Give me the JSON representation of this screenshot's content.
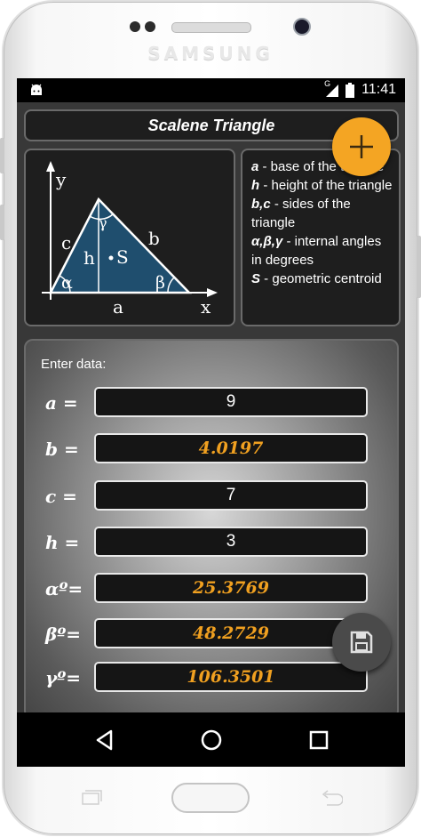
{
  "device": {
    "brand": "SAMSUNG"
  },
  "status_bar": {
    "network_label": "G",
    "time": "11:41"
  },
  "app": {
    "title": "Scalene Triangle",
    "diagram": {
      "axis_y": "y",
      "axis_x": "x",
      "side_a": "a",
      "side_b": "b",
      "side_c": "c",
      "height": "h",
      "centroid": "S",
      "angle_alpha": "α",
      "angle_beta": "β",
      "angle_gamma": "γ"
    },
    "legend": [
      {
        "key": "a",
        "text": " - base of the triangle"
      },
      {
        "key": "h",
        "text": " - height of the triangle"
      },
      {
        "key": "b,c",
        "text": " - sides of the triangle"
      },
      {
        "key": "α,β,γ",
        "text": " - internal angles in degrees"
      },
      {
        "key": "S",
        "text": " - geometric centroid"
      }
    ],
    "form": {
      "label": "Enter data:",
      "fields": [
        {
          "label": "a =",
          "value": "9",
          "computed": false
        },
        {
          "label": "b =",
          "value": "4.0197",
          "computed": true
        },
        {
          "label": "c =",
          "value": "7",
          "computed": false
        },
        {
          "label": "h =",
          "value": "3",
          "computed": false
        },
        {
          "label": "αº=",
          "value": "25.3769",
          "computed": true
        },
        {
          "label": "βº=",
          "value": "48.2729",
          "computed": true
        },
        {
          "label": "γº=",
          "value": "106.3501",
          "computed": true
        }
      ]
    },
    "colors": {
      "accent": "#f4a523",
      "computed_text": "#f0a020",
      "triangle_fill": "#1f4e6e"
    },
    "icons": {
      "add": "plus-icon",
      "save": "floppy-disk-icon"
    }
  }
}
